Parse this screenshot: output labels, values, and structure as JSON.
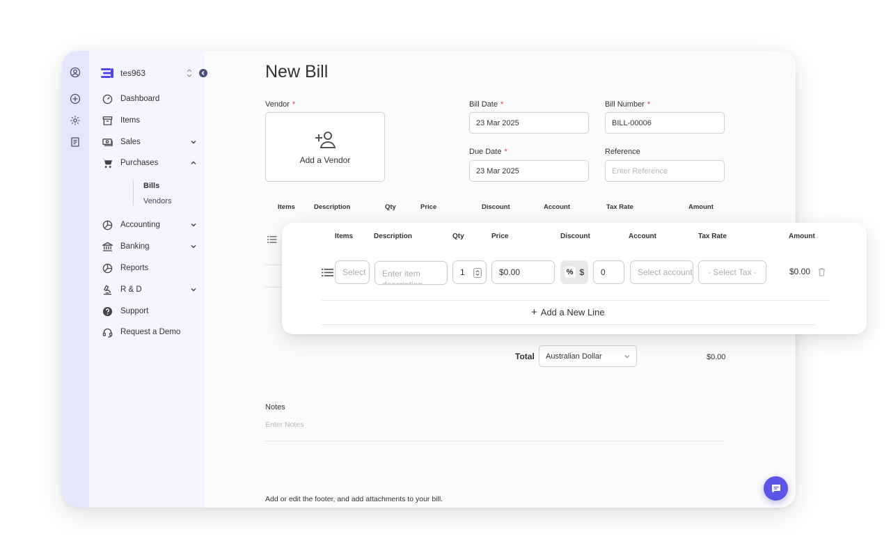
{
  "workspace": {
    "name": "tes963"
  },
  "sidebar": {
    "items": [
      {
        "label": "Dashboard"
      },
      {
        "label": "Items"
      },
      {
        "label": "Sales"
      },
      {
        "label": "Purchases"
      },
      {
        "label": "Accounting"
      },
      {
        "label": "Banking"
      },
      {
        "label": "Reports"
      },
      {
        "label": "R & D"
      },
      {
        "label": "Support"
      },
      {
        "label": "Request a Demo"
      }
    ],
    "purchases_sub": [
      {
        "label": "Bills",
        "active": true
      },
      {
        "label": "Vendors"
      }
    ]
  },
  "page": {
    "title": "New Bill"
  },
  "form": {
    "vendor_label": "Vendor",
    "add_vendor": "Add a Vendor",
    "bill_date_label": "Bill Date",
    "bill_date_value": "23 Mar 2025",
    "bill_number_label": "Bill Number",
    "bill_number_value": "BILL-00006",
    "due_date_label": "Due Date",
    "due_date_value": "23 Mar 2025",
    "reference_label": "Reference",
    "reference_placeholder": "Enter Reference",
    "required_mark": "*"
  },
  "table": {
    "headers": [
      "Items",
      "Description",
      "Qty",
      "Price",
      "Discount",
      "Account",
      "Tax Rate",
      "Amount"
    ]
  },
  "line_item": {
    "item_placeholder": "Select",
    "description_placeholder": "Enter item description",
    "qty": "1",
    "price": "$0.00",
    "discount_pct": "%",
    "discount_dollar": "$",
    "discount_value": "0",
    "account_placeholder": "Select account",
    "tax_placeholder": "- Select Tax -",
    "amount": "$0.00",
    "add_line": "Add a New Line"
  },
  "totals": {
    "label": "Total",
    "currency": "Australian Dollar",
    "value": "$0.00"
  },
  "notes": {
    "label": "Notes",
    "placeholder": "Enter Notes"
  },
  "footer": {
    "text": "Add or edit the footer, and add attachments to your bill."
  },
  "colors": {
    "accent": "#5b55e8",
    "rail": "#e4e6fb",
    "sidebar": "#f4f5fe",
    "required": "#e03b3b"
  }
}
